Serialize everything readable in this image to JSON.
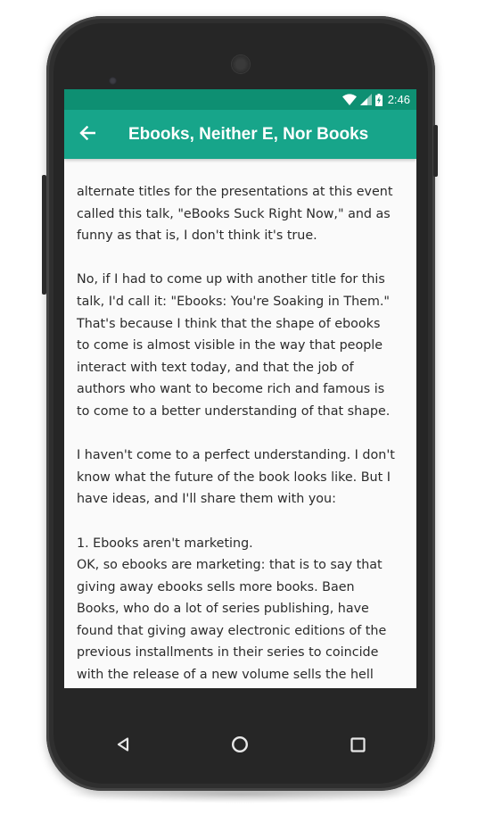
{
  "status_bar": {
    "time": "2:46",
    "icons": [
      "wifi-icon",
      "cellular-signal-icon",
      "battery-charging-icon"
    ]
  },
  "app_bar": {
    "title": "Ebooks, Neither E, Nor Books",
    "back_icon": "arrow-back-icon"
  },
  "article": {
    "paragraphs": [
      {
        "lines": [
          "alternate titles for the presentations at this event",
          "called this talk, \"eBooks Suck Right Now,\" and as",
          "funny as that is, I don't think it's true."
        ]
      },
      {
        "lines": [
          "No, if I had to come up with another title for this",
          "talk, I'd call it: \"Ebooks: You're Soaking in Them.\"",
          "That's because I think that the shape of ebooks",
          "to come is almost visible in the way that people",
          "interact with text today, and that the job of",
          "authors who want to become rich and famous is",
          "to come to a better understanding of that shape."
        ]
      },
      {
        "lines": [
          "I haven't come to a perfect understanding. I don't",
          "know what the future of the book looks like. But I",
          "have ideas, and I'll share them with you:"
        ]
      },
      {
        "lines": [
          "1. Ebooks aren't marketing.",
          "OK, so ebooks are marketing: that is to say that",
          "giving away ebooks sells more books. Baen",
          "Books, who do a lot of series publishing, have",
          "found that giving away electronic editions of the",
          "previous installments in their series to coincide",
          "with the release of a new volume sells the hell"
        ]
      }
    ]
  },
  "nav_bar": {
    "buttons": [
      "back-triangle-icon",
      "home-circle-icon",
      "recents-square-icon"
    ]
  },
  "colors": {
    "status_bar": "#0e8f72",
    "app_bar": "#17a58a",
    "screen_bg": "#fafafa",
    "text": "#2b2b2b"
  }
}
